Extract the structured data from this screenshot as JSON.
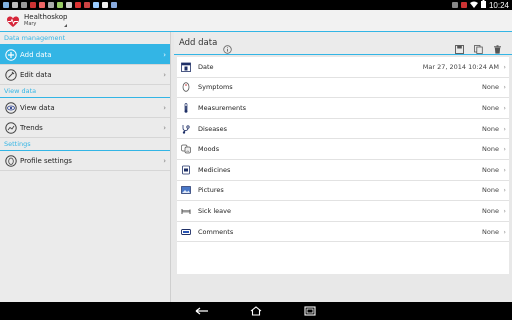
{
  "status_bar": {
    "time": "10:24"
  },
  "app": {
    "title": "Healthoskop",
    "subtitle": "Mary"
  },
  "sidebar": {
    "sections": [
      {
        "header": "Data management",
        "items": [
          {
            "label": "Add data",
            "icon": "plus-circle-icon",
            "active": true
          },
          {
            "label": "Edit data",
            "icon": "pencil-circle-icon",
            "active": false
          }
        ]
      },
      {
        "header": "View data",
        "items": [
          {
            "label": "View data",
            "icon": "eye-icon",
            "active": false
          },
          {
            "label": "Trends",
            "icon": "trend-chart-icon",
            "active": false
          }
        ]
      },
      {
        "header": "Settings",
        "items": [
          {
            "label": "Profile settings",
            "icon": "profile-icon",
            "active": false
          }
        ]
      }
    ]
  },
  "content": {
    "title": "Add data",
    "rows": [
      {
        "label": "Date",
        "value": "Mar 27, 2014 10:24 AM",
        "icon": "calendar-icon"
      },
      {
        "label": "Symptoms",
        "value": "None",
        "icon": "body-icon"
      },
      {
        "label": "Measurements",
        "value": "None",
        "icon": "thermometer-icon"
      },
      {
        "label": "Diseases",
        "value": "None",
        "icon": "stethoscope-icon"
      },
      {
        "label": "Moods",
        "value": "None",
        "icon": "mood-masks-icon"
      },
      {
        "label": "Medicines",
        "value": "None",
        "icon": "pill-icon"
      },
      {
        "label": "Pictures",
        "value": "None",
        "icon": "picture-icon"
      },
      {
        "label": "Sick leave",
        "value": "None",
        "icon": "bed-icon"
      },
      {
        "label": "Comments",
        "value": "None",
        "icon": "comment-icon"
      }
    ]
  },
  "colors": {
    "accent": "#33b5e5",
    "heart": "#d6263a"
  }
}
